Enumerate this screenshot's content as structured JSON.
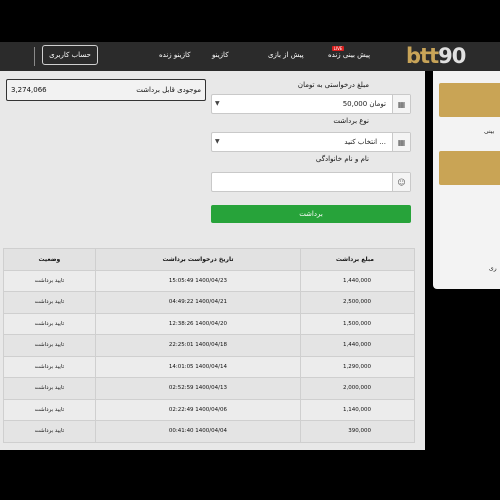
{
  "header": {
    "logo_b": "btt",
    "logo_d": "90",
    "nav": {
      "live_prediction": "پیش بینی زنده",
      "live_badge": "LIVE",
      "pre_match": "پیش از بازی",
      "casino": "کازینو",
      "live_casino": "کازینو زنده"
    },
    "account_button": "حساب کاربری"
  },
  "balance": {
    "label": "موجودی قابل برداشت",
    "value": "3,274,066"
  },
  "form": {
    "amount_label": "مبلغ درخواستی به تومان",
    "amount_value": "50,000 تومان",
    "type_label": "نوع برداشت",
    "type_value": "انتخاب کنید ...",
    "name_label": "نام و نام خانوادگی",
    "name_value": "",
    "submit_label": "برداشت"
  },
  "table": {
    "headers": {
      "amount": "مبلغ برداشت",
      "date": "تاریخ درخواست برداشت",
      "status": "وضعیت"
    },
    "rows": [
      {
        "amount": "1,440,000",
        "date": "15:05:49 1400/04/23",
        "status": "تایید برداشت"
      },
      {
        "amount": "2,500,000",
        "date": "04:49:22 1400/04/21",
        "status": "تایید برداشت"
      },
      {
        "amount": "1,500,000",
        "date": "12:38:26 1400/04/20",
        "status": "تایید برداشت"
      },
      {
        "amount": "1,440,000",
        "date": "22:25:01 1400/04/18",
        "status": "تایید برداشت"
      },
      {
        "amount": "1,290,000",
        "date": "14:01:05 1400/04/14",
        "status": "تایید برداشت"
      },
      {
        "amount": "2,000,000",
        "date": "02:52:59 1400/04/13",
        "status": "تایید برداشت"
      },
      {
        "amount": "1,140,000",
        "date": "02:22:49 1400/04/06",
        "status": "تایید برداشت"
      },
      {
        "amount": "390,000",
        "date": "00:41:40 1400/04/04",
        "status": "تایید برداشت"
      }
    ]
  },
  "side_panel": {
    "text1": "بینی",
    "text2": "ری"
  },
  "colors": {
    "header_bg": "#2b2b2b",
    "gold": "#c9a455",
    "submit_green": "#27a33a",
    "live_red": "#d9201f"
  },
  "icons": [
    "calculator-icon",
    "calculator-icon",
    "user-icon",
    "chevron-down-icon"
  ]
}
